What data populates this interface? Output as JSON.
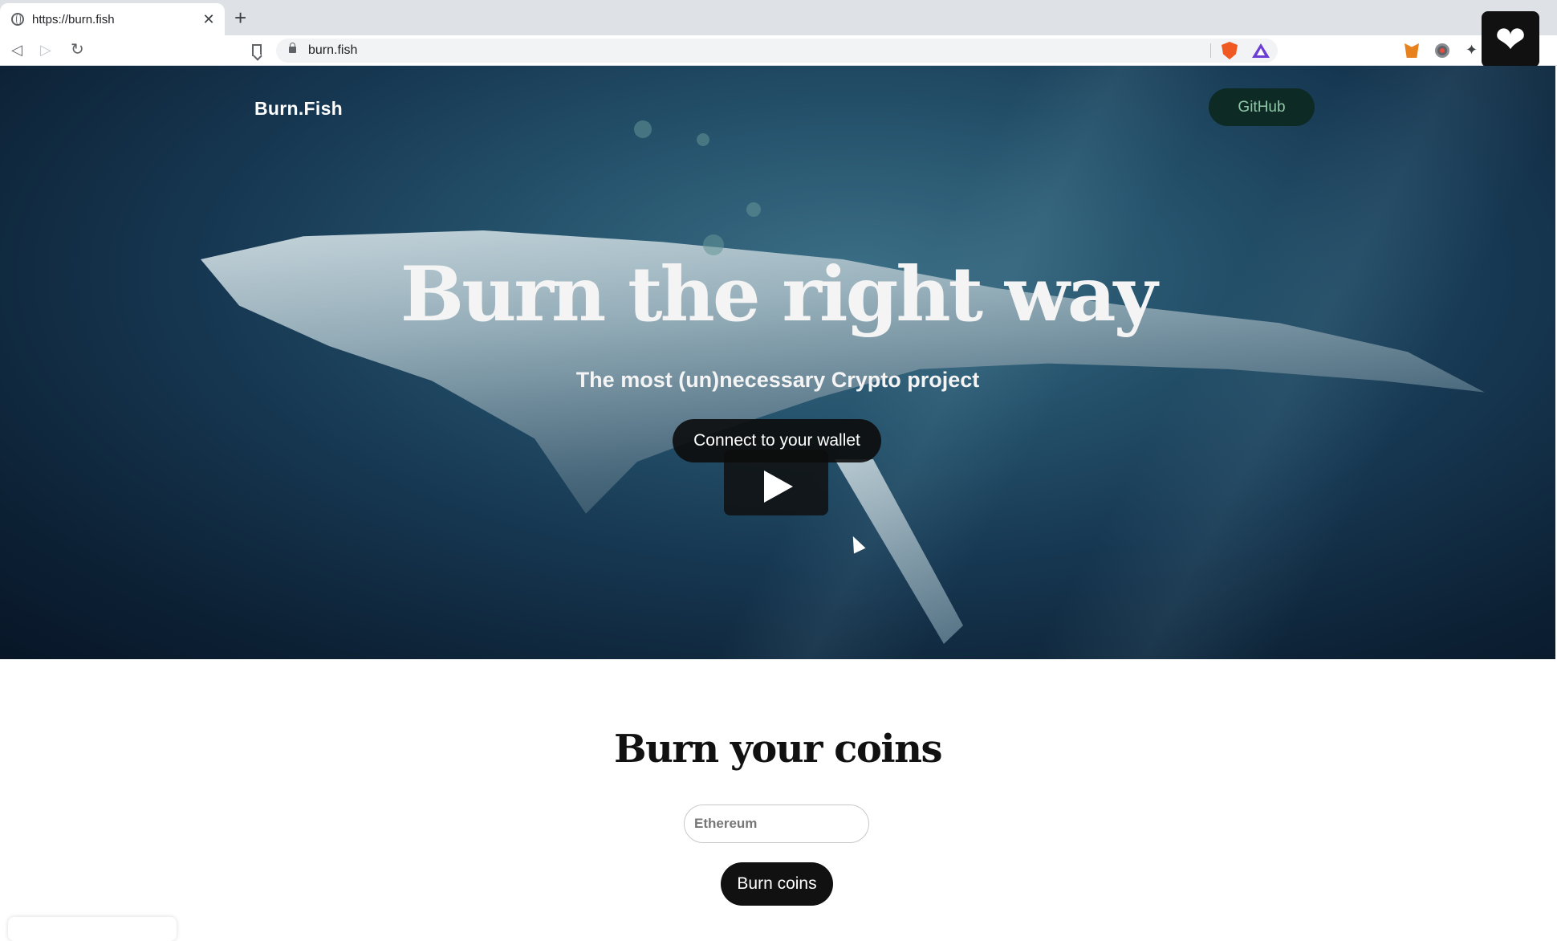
{
  "browser": {
    "tab_title": "https://burn.fish",
    "tab_close": "✕",
    "new_tab": "+",
    "url": "burn.fish",
    "nav": {
      "back": "◁",
      "forward": "▷",
      "reload": "↻"
    },
    "extensions": [
      "fox-extension-icon",
      "record-extension-icon",
      "puzzle-extensions-icon"
    ],
    "puzzle_glyph": "✦"
  },
  "widget": {
    "heart": "❤"
  },
  "site": {
    "brand": "Burn.Fish",
    "github_label": "GitHub",
    "hero_title": "Burn the right way",
    "hero_subtitle": "The most (un)necessary Crypto project",
    "connect_label": "Connect to your wallet",
    "burn_section": {
      "title": "Burn your coins",
      "input_placeholder": "Ethereum",
      "button_label": "Burn coins"
    }
  },
  "colors": {
    "hero_deep": "#081627",
    "hero_mid": "#24506a",
    "github_bg": "#0d2a24",
    "github_text": "#8fc9a8",
    "button_dark": "#111111"
  }
}
